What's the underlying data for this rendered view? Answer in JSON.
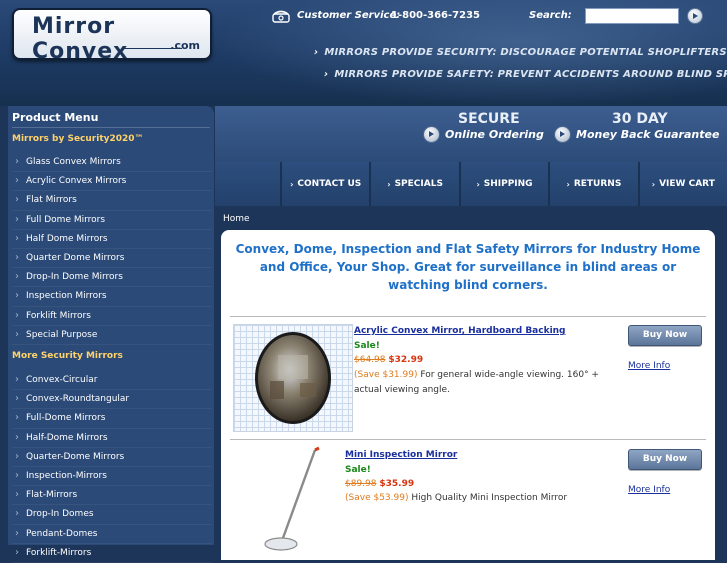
{
  "header": {
    "logo_text": "Mirror Convex",
    "logo_suffix": ".com",
    "customer_service_label": "Customer Service:",
    "phone": "1-800-366-7235",
    "search_label": "Search:",
    "search_value": "",
    "taglines": [
      "MIRRORS PROVIDE SECURITY: DISCOURAGE POTENTIAL SHOPLIFTERS",
      "MIRRORS PROVIDE SAFETY: PREVENT ACCIDENTS AROUND BLIND SPOTS"
    ]
  },
  "promo": {
    "secure_head": "SECURE",
    "secure_sub": "Online Ordering",
    "guarantee_head": "30 DAY",
    "guarantee_sub": "Money Back Guarantee"
  },
  "nav": {
    "items": [
      "CONTACT US",
      "SPECIALS",
      "SHIPPING",
      "RETURNS",
      "VIEW CART"
    ]
  },
  "sidebar": {
    "title": "Product Menu",
    "section1": "Mirrors by Security2020™",
    "section1_items": [
      "Glass Convex Mirrors",
      "Acrylic Convex Mirrors",
      "Flat Mirrors",
      "Full Dome Mirrors",
      "Half Dome Mirrors",
      "Quarter Dome Mirrors",
      "Drop-In Dome Mirrors",
      "Inspection Mirrors",
      "Forklift Mirrors",
      "Special Purpose"
    ],
    "section2": "More Security Mirrors",
    "section2_items": [
      "Convex-Circular",
      "Convex-Roundtangular",
      "Full-Dome Mirrors",
      "Half-Dome Mirrors",
      "Quarter-Dome Mirrors",
      "Inspection-Mirrors",
      "Flat-Mirrors",
      "Drop-In Domes",
      "Pendant-Domes",
      "Forklift-Mirrors"
    ]
  },
  "breadcrumb": "Home",
  "main": {
    "headline": "Convex, Dome, Inspection and Flat Safety Mirrors for Industry Home and Office, Your Shop. Great for surveillance in blind areas or watching blind corners.",
    "products": [
      {
        "name": "Acrylic Convex Mirror, Hardboard Backing",
        "sale_label": "Sale!",
        "old_price": "$64.98",
        "new_price": "$32.99",
        "savings": "(Save $31.99)",
        "description": "For general wide-angle viewing. 160° + actual viewing angle.",
        "buy_label": "Buy Now",
        "more_info": "More Info"
      },
      {
        "name": "Mini Inspection Mirror",
        "sale_label": "Sale!",
        "old_price": "$89.98",
        "new_price": "$35.99",
        "savings": "(Save $53.99)",
        "description": "High Quality Mini Inspection Mirror",
        "buy_label": "Buy Now",
        "more_info": "More Info"
      }
    ]
  },
  "colors": {
    "background": "#1c3558",
    "sidebar": "#2b4a78",
    "section_heading": "#ffd36a",
    "headline": "#1f70c8",
    "sale": "#1a8a1a",
    "old_price": "#e07b1e",
    "new_price": "#d9330e"
  }
}
